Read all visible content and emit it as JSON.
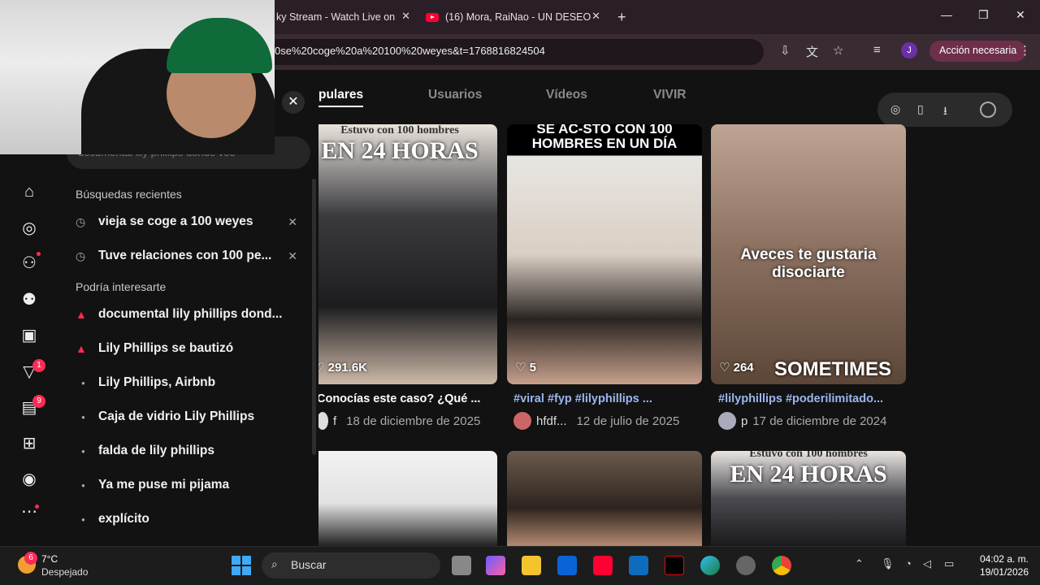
{
  "browser": {
    "tabs": [
      {
        "title": "ky Stream - Watch Live on"
      },
      {
        "title": "(16) Mora, RaiNao - UN DESEO"
      }
    ],
    "new_tab_label": "+",
    "url": "0se%20coge%20a%20100%20weyes&t=1768816824504",
    "profile_initial": "J",
    "action_label": "Acción necesaria"
  },
  "search_tabs": [
    {
      "label": "pulares",
      "active": true
    },
    {
      "label": "Usuarios",
      "active": false
    },
    {
      "label": "Vídeos",
      "active": false
    },
    {
      "label": "VIVIR",
      "active": false
    }
  ],
  "search": {
    "query": "documental lily phillips donde veo",
    "recent_heading": "Búsquedas recientes",
    "recent": [
      "vieja se coge a 100 weyes",
      "Tuve relaciones con 100 pe..."
    ],
    "suggest_heading": "Podría interesarte",
    "suggestions": [
      {
        "text": "documental lily phillips dond...",
        "trending": true
      },
      {
        "text": "Lily Phillips se bautizó",
        "trending": true
      },
      {
        "text": "Lily Phillips, Airbnb",
        "trending": false
      },
      {
        "text": "Caja de vidrio Lily Phillips",
        "trending": false
      },
      {
        "text": "falda de lily phillips",
        "trending": false
      },
      {
        "text": "Ya me puse mi pijama",
        "trending": false
      },
      {
        "text": "explícito",
        "trending": false
      }
    ]
  },
  "sidebar": {
    "icons": [
      "home-icon",
      "explore-icon",
      "following-icon",
      "friends-icon",
      "live-icon",
      "activity-icon",
      "messages-icon",
      "upload-icon",
      "profile-icon",
      "more-icon"
    ],
    "badges": {
      "activity": "1",
      "messages": "9"
    }
  },
  "videos": [
    {
      "overlay_top": "Estuvo con 100 hombres",
      "overlay_big": "EN 24 HORAS",
      "likes": "291.6K",
      "desc": "Conocías este caso? ¿Qué ...",
      "desc_is_tag": false,
      "user": "f",
      "date": "18 de diciembre de 2025"
    },
    {
      "overlay_top": "SE AC-STO CON 100",
      "overlay_big": "HOMBRES EN UN DÍA",
      "likes": "5",
      "desc": "#viral #fyp #lilyphillips ...",
      "desc_is_tag": true,
      "user": "hfdf...",
      "date": "12 de julio de 2025"
    },
    {
      "overlay_top": "Aveces te gustaria",
      "overlay_big": "disociarte",
      "overlay_bottom": "SOMETIMES",
      "likes": "264",
      "desc": "#lilyphillips #poderilimitado...",
      "desc_is_tag": true,
      "user": "p",
      "date": "17 de diciembre de 2024"
    },
    {
      "overlay_top": "",
      "overlay_big": ""
    },
    {
      "overlay_top": "",
      "overlay_big": ""
    },
    {
      "overlay_top": "Estuvo con 100 hombres",
      "overlay_big": "EN 24 HORAS"
    }
  ],
  "taskbar": {
    "weather_badge": "6",
    "temp": "7°C",
    "weather": "Despejado",
    "search_label": "Buscar",
    "time": "04:02 a. m.",
    "date": "19/01/2026"
  },
  "colors": {
    "tiktok_red": "#fe2c55",
    "tag_blue": "#9ab6ee",
    "browser_frame": "#2a1f26"
  }
}
